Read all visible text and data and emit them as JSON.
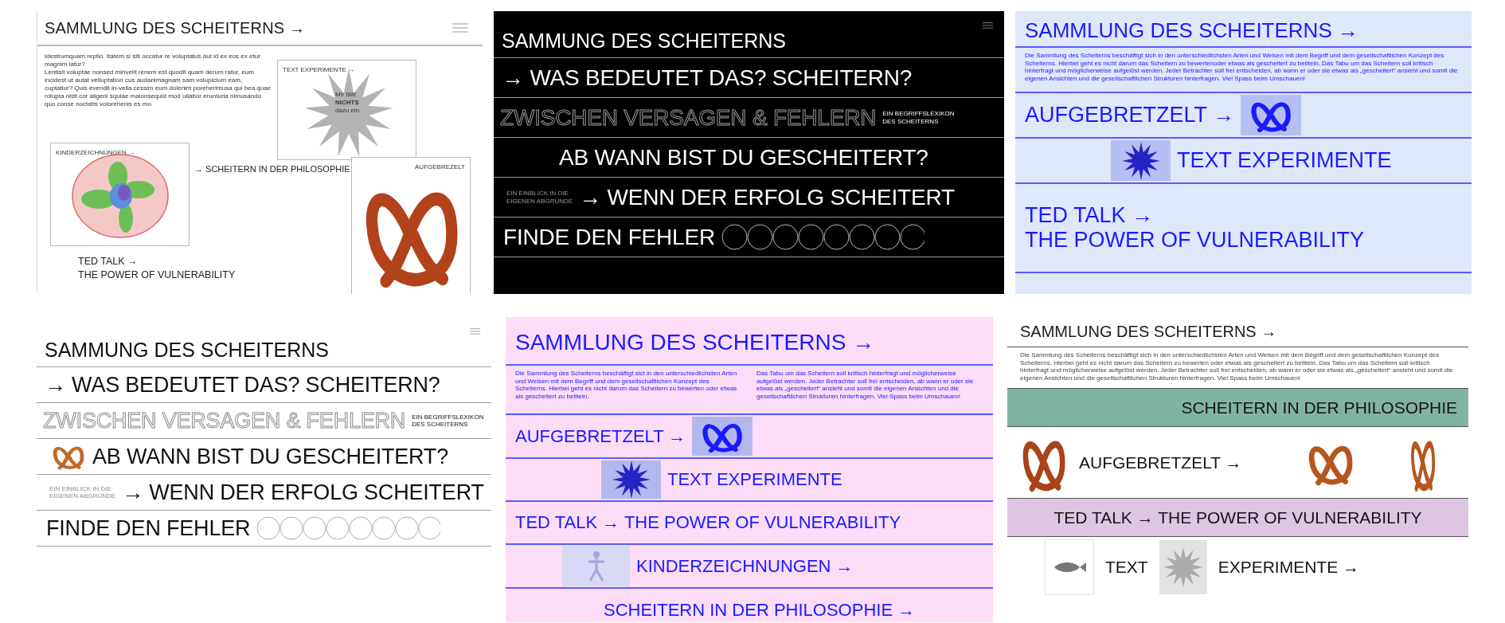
{
  "panels": [
    {
      "kind": "collage",
      "title": "SAMMLUNG DES SCHEITERNS →",
      "paragraphs": [
        "Idestrumquam reptio. Itatem si siti occatur re voluptatus aut id ex eos ex etur magnim latur?",
        "Lentisit voluptae nonsed minvelit renem est quodit quam derum ratur, eum incidest ut autat velluptation cus audanimagnam sam volupicium eam, cuptatiur? Quis evendit in-vella cessim eum dolenim poreherimusa qui bea quae rolupta nisti cor aligeni squiae maionsequid mod ullabor erunturia nimusando quo conse noctatis volorehenis es mo"
      ],
      "text_card": {
        "label": "TEXT EXPERIMENTE →",
        "burst_text": [
          "Mir fällt",
          "**NICHTS**",
          "dazu ein."
        ]
      },
      "drawing_card": {
        "label": "KINDERZEICHNUNGEN →"
      },
      "photo_card": {
        "label": "AUFGEBREZELT"
      },
      "philosophy_link": "→ SCHEITERN IN DER PHILOSOPHIE",
      "ted_link": [
        "TED TALK →",
        "THE POWER OF VULNERABILITY"
      ]
    },
    {
      "kind": "darkstack",
      "title": "SAMMUNG DES SCHEITERNS",
      "rows": [
        {
          "kind": "plain",
          "text": "→ WAS BEDEUTET DAS? SCHEITERN?"
        },
        {
          "kind": "outline",
          "text": "ZWISCHEN VERSAGEN & FEHLERN",
          "note": [
            "EIN BEGRIFFSLEXIKON",
            "DES SCHEITERNS"
          ]
        },
        {
          "kind": "indented",
          "text": "AB WANN BIST DU GESCHEITERT?"
        },
        {
          "kind": "noted",
          "note": [
            "EIN EINBLICK IN DIE",
            "EIGENEN ABGRÜNDE"
          ],
          "text": "→ WENN DER ERFOLG SCHEITERT"
        },
        {
          "kind": "circles",
          "text": "FINDE DEN FEHLER"
        }
      ]
    },
    {
      "kind": "bluelist",
      "title": "SAMMLUNG DES SCHEITERNS →",
      "intro": [
        "Die Sammlung des Scheiterns beschäftigt sich in den unterschiedlichsten Arten und Weisen mit dem Begriff und dem gesellschaftlichen Konzept des Scheiterns. Hierbei geht es nicht darum das Scheitern zu bewertenoder etwas als gescheitert zu betiteln. Das Tabu um das Scheitern soll kritisch hinterfragt und möglicherweise aufgelöst werden. Jeder Betrachter soll frei entscheiden, ab wann er oder sie etwas als „gescheitert“ ansieht und somit die eigenen Ansichten und die gesellschaftlichen Strukturen hinterfragen. Viel Spass beim Umschauen!"
      ],
      "rows": [
        {
          "kind": "image-after",
          "text": "AUFGEBRETZELT →"
        },
        {
          "kind": "burst-before",
          "text": "TEXT EXPERIMENTE"
        },
        {
          "kind": "tall",
          "lines": [
            "TED TALK →",
            "THE POWER OF VULNERABILITY"
          ]
        }
      ]
    },
    {
      "kind": "lightstack",
      "title": "SAMMUNG DES SCHEITERNS",
      "rows": [
        {
          "kind": "plain",
          "text": "→ WAS BEDEUTET DAS? SCHEITERN?"
        },
        {
          "kind": "outline",
          "text": "ZWISCHEN VERSAGEN & FEHLERN",
          "note": [
            "EIN BEGRIFFSLEXIKON",
            "DES SCHEITERNS"
          ]
        },
        {
          "kind": "pretzel",
          "text": "AB WANN BIST DU GESCHEITERT?"
        },
        {
          "kind": "noted",
          "note": [
            "EIN EINBLICK IN DIE",
            "EIGENEN ABGRÜNDE"
          ],
          "text": "→ WENN DER ERFOLG SCHEITERT"
        },
        {
          "kind": "circles",
          "text": "FINDE DEN FEHLER"
        }
      ]
    },
    {
      "kind": "pinklist",
      "title": "SAMMLUNG DES SCHEITERNS →",
      "intro": [
        "Die Sammlung des Scheiterns beschäftigt sict in den unterschiedlichsten Arten und Weisen mit dem Begriff und dem gesellschaftlichen Konzept des Scheiterns. Hierbei geht es nicht darum das Scheitern zu bewerten oder etwas als gescheitert zu betiteln.",
        "Das Tabu um das Scheitern soll kritisch hinterfragt und möglicherweise aufgelöst werden. Jeder Betrachter soll frei entscheiden, ab wann er oder sie etwas als „gescheitert“ ansieht und somit die eigenen Ansichten und die gesellschaftlichen Strukturen hinterfragen. Viel Spass beim Umschauen!"
      ],
      "rows": [
        {
          "kind": "image-after",
          "text": "AUFGEBRETZELT →"
        },
        {
          "kind": "burst-before",
          "text": "TEXT EXPERIMENTE"
        },
        {
          "kind": "plain",
          "text": "TED TALK → THE POWER OF VULNERABILITY"
        },
        {
          "kind": "figure-before",
          "text": "KINDERZEICHNUNGEN →"
        },
        {
          "kind": "indented",
          "text": "SCHEITERN IN DER PHILOSOPHIE →"
        }
      ]
    },
    {
      "kind": "bands",
      "title": "SAMMLUNG DES SCHEITERNS →",
      "intro": "Die Sammlung des Scheiterns beschäftigt sich in den unterschiedlichsten Arten und Weisen mit dem Begriff und dem gesellschaftlichen Konzept des Scheiterns. Hierbei geht es nicht darum das Scheitern zu bewerten oder etwas als gescheitert zu betiteln. Das Tabu um das Scheitern soll kritisch hinterfragt und möglicherweise aufgelöst werden. Jeder Betrachter soll frei entscheiden, ab wann er oder sie etwas als „gescheitert“ ansieht und somit die eigenen Ansichten und die gesellschaftlichen Strukturen hinterfragen. Viel Spass beim Umschauen!",
      "rows": [
        {
          "kind": "band-right",
          "color": "#80b3a0",
          "text": "SCHEITERN IN DER PHILOSOPHIE"
        },
        {
          "kind": "pretzels",
          "text": "AUFGEBRETZELT →"
        },
        {
          "kind": "band-center",
          "color": "#dcc6e2",
          "text": "TED TALK → THE POWER OF VULNERABILITY"
        },
        {
          "kind": "split",
          "parts": [
            "TEXT",
            "EXPERIMENTE →"
          ]
        }
      ]
    }
  ]
}
